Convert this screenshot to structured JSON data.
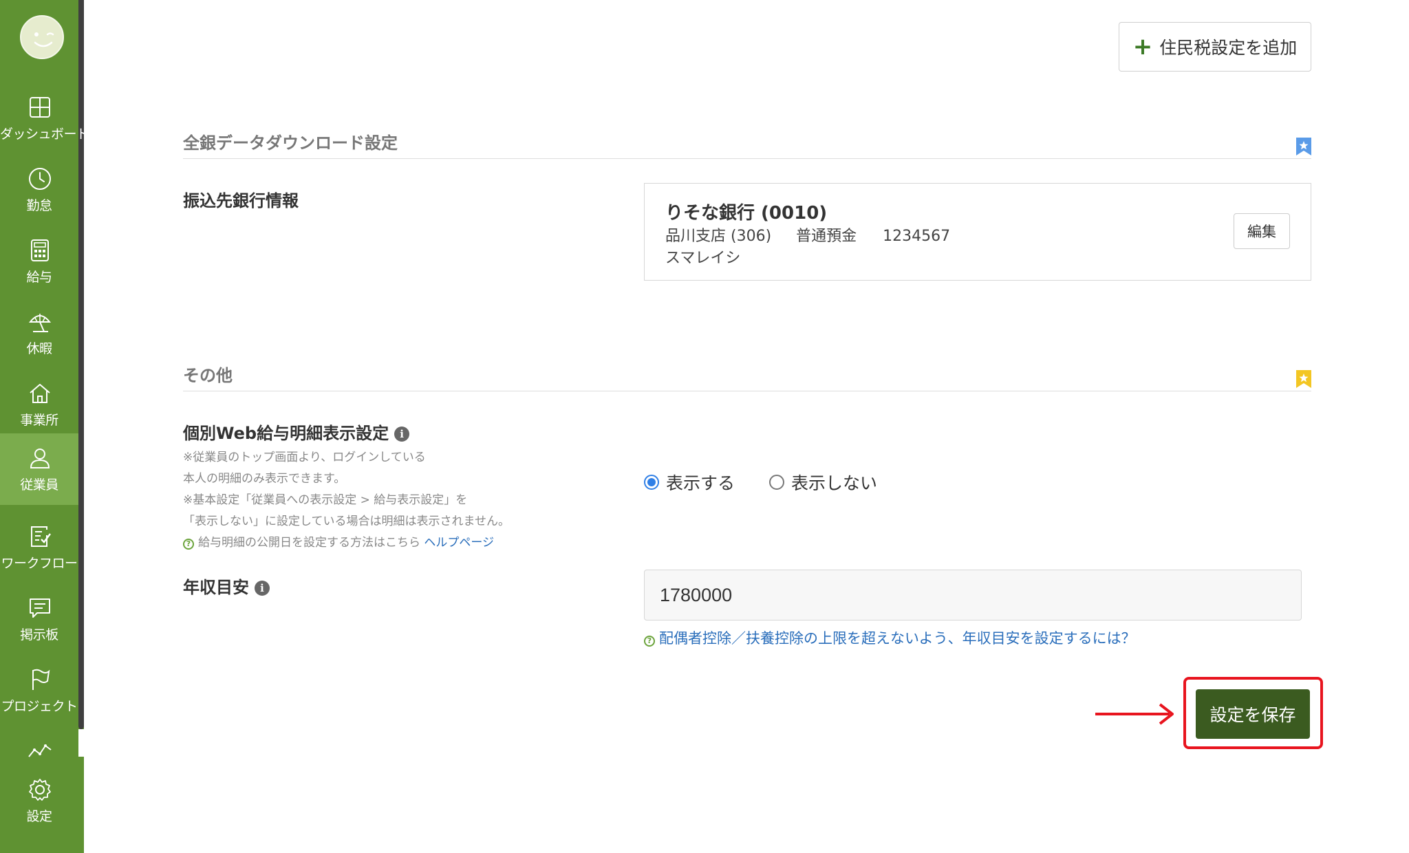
{
  "sidebar": {
    "items": [
      {
        "label": "ダッシュボード",
        "icon": "dashboard-icon"
      },
      {
        "label": "勤怠",
        "icon": "clock-icon"
      },
      {
        "label": "給与",
        "icon": "calculator-icon"
      },
      {
        "label": "休暇",
        "icon": "beach-umbrella-icon"
      },
      {
        "label": "事業所",
        "icon": "home-icon"
      },
      {
        "label": "従業員",
        "icon": "person-icon"
      },
      {
        "label": "ワークフロー",
        "icon": "checklist-icon"
      },
      {
        "label": "掲示板",
        "icon": "chat-icon"
      },
      {
        "label": "プロジェクト",
        "icon": "flag-icon"
      },
      {
        "label": "",
        "icon": "line-chart-icon"
      },
      {
        "label": "設定",
        "icon": "gear-icon"
      }
    ],
    "active_label": "従業員"
  },
  "header": {
    "add_resident_tax_label": "住民税設定を追加"
  },
  "bank_section": {
    "title": "全銀データダウンロード設定",
    "field_label": "振込先銀行情報",
    "bank_name": "りそな銀行 (0010)",
    "branch": "品川支店 (306)",
    "account_type": "普通預金",
    "account_number": "1234567",
    "holder": "スマレイシ",
    "edit_label": "編集"
  },
  "other_section": {
    "title": "その他",
    "web_payslip_label": "個別Web給与明細表示設定",
    "notes": [
      "※従業員のトップ画面より、ログインしている",
      "本人の明細のみ表示できます。",
      "※基本設定「従業員への表示設定 > 給与表示設定」を",
      "「表示しない」に設定している場合は明細は表示されません。"
    ],
    "help_text": "給与明細の公開日を設定する方法はこちら",
    "help_link": "ヘルプページ",
    "radio_show": "表示する",
    "radio_hide": "表示しない",
    "selected": "表示する",
    "annual_income_label": "年収目安",
    "annual_income_value": "1780000",
    "annual_income_help": "配偶者控除／扶養控除の上限を超えないよう、年収目安を設定するには？"
  },
  "save_button_label": "設定を保存",
  "colors": {
    "sidebar": "#5f9232",
    "sidebar_active": "#7bac4d",
    "save_button": "#3b5b20",
    "highlight": "#e8141e",
    "link": "#2a6ebb",
    "radio": "#2f7fe6"
  }
}
